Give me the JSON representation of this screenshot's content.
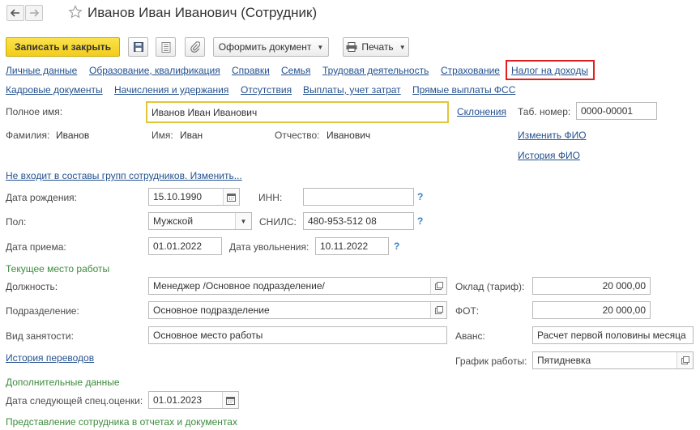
{
  "header": {
    "title": "Иванов Иван Иванович (Сотрудник)"
  },
  "toolbar": {
    "save_close": "Записать и закрыть",
    "create_document": "Оформить документ",
    "print": "Печать"
  },
  "tabs_row1": [
    "Личные данные",
    "Образование, квалификация",
    "Справки",
    "Семья",
    "Трудовая деятельность",
    "Страхование",
    "Налог на доходы"
  ],
  "tabs_row2": [
    "Кадровые документы",
    "Начисления и удержания",
    "Отсутствия",
    "Выплаты, учет затрат",
    "Прямые выплаты ФСС"
  ],
  "form": {
    "full_name_label": "Полное имя:",
    "full_name_value": "Иванов Иван Иванович",
    "declensions_link": "Склонения",
    "tab_number_label": "Таб. номер:",
    "tab_number_value": "0000-00001",
    "surname_label": "Фамилия:",
    "surname_value": "Иванов",
    "name_label": "Имя:",
    "name_value": "Иван",
    "patronymic_label": "Отчество:",
    "patronymic_value": "Иванович",
    "change_fio_link": "Изменить ФИО",
    "fio_history_link": "История ФИО",
    "groups_link": "Не входит в составы групп сотрудников. Изменить...",
    "birth_date_label": "Дата рождения:",
    "birth_date_value": "15.10.1990",
    "inn_label": "ИНН:",
    "inn_value": "",
    "gender_label": "Пол:",
    "gender_value": "Мужской",
    "snils_label": "СНИЛС:",
    "snils_value": "480-953-512 08",
    "hire_date_label": "Дата приема:",
    "hire_date_value": "01.01.2022",
    "dismissal_date_label": "Дата увольнения:",
    "dismissal_date_value": "10.11.2022",
    "help_mark": "?"
  },
  "workplace": {
    "section_title": "Текущее место работы",
    "position_label": "Должность:",
    "position_value": "Менеджер /Основное подразделение/",
    "department_label": "Подразделение:",
    "department_value": "Основное подразделение",
    "employment_label": "Вид занятости:",
    "employment_value": "Основное место работы",
    "transfer_history_link": "История переводов",
    "salary_label": "Оклад (тариф):",
    "salary_value": "20 000,00",
    "fot_label": "ФОТ:",
    "fot_value": "20 000,00",
    "advance_label": "Аванс:",
    "advance_value": "Расчет первой половины месяца",
    "schedule_label": "График работы:",
    "schedule_value": "Пятидневка"
  },
  "additional": {
    "section_title": "Дополнительные данные",
    "next_assessment_label": "Дата следующей спец.оценки:",
    "next_assessment_value": "01.01.2023",
    "representation_title": "Представление сотрудника в отчетах и документах"
  },
  "colors": {
    "primary_button": "#f2cd1a",
    "link": "#24518f",
    "section_green": "#3c8b3c",
    "highlight_red": "#e02020",
    "focus_yellow": "#e5c53a"
  }
}
